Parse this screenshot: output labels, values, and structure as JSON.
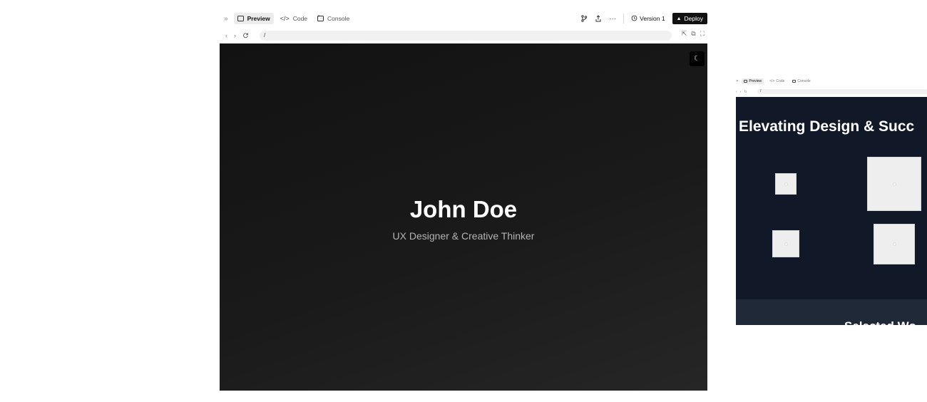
{
  "main": {
    "toolbar": {
      "collapse_icon": "»",
      "tabs": [
        {
          "label": "Preview",
          "active": true
        },
        {
          "label": "Code",
          "active": false
        },
        {
          "label": "Console",
          "active": false
        }
      ],
      "version_label": "Version 1",
      "deploy_label": "Deploy",
      "branch_icon": "branch-icon",
      "share_icon": "share-icon",
      "more_icon": "more-icon"
    },
    "address": {
      "url": "/"
    },
    "hero": {
      "name": "John Doe",
      "subtitle": "UX Designer & Creative Thinker"
    },
    "theme_toggle_icon": "moon-icon"
  },
  "mini": {
    "toolbar": {
      "tabs": [
        {
          "label": "Preview",
          "active": true
        },
        {
          "label": "Code",
          "active": false
        },
        {
          "label": "Console",
          "active": false
        }
      ]
    },
    "address": {
      "url": "/"
    },
    "heading": "Elevating Design & Succ",
    "section_title": "Selected Wo",
    "colors": {
      "background": "#111827",
      "band": "#1f2937",
      "image_placeholder": "#eeeeee"
    }
  }
}
